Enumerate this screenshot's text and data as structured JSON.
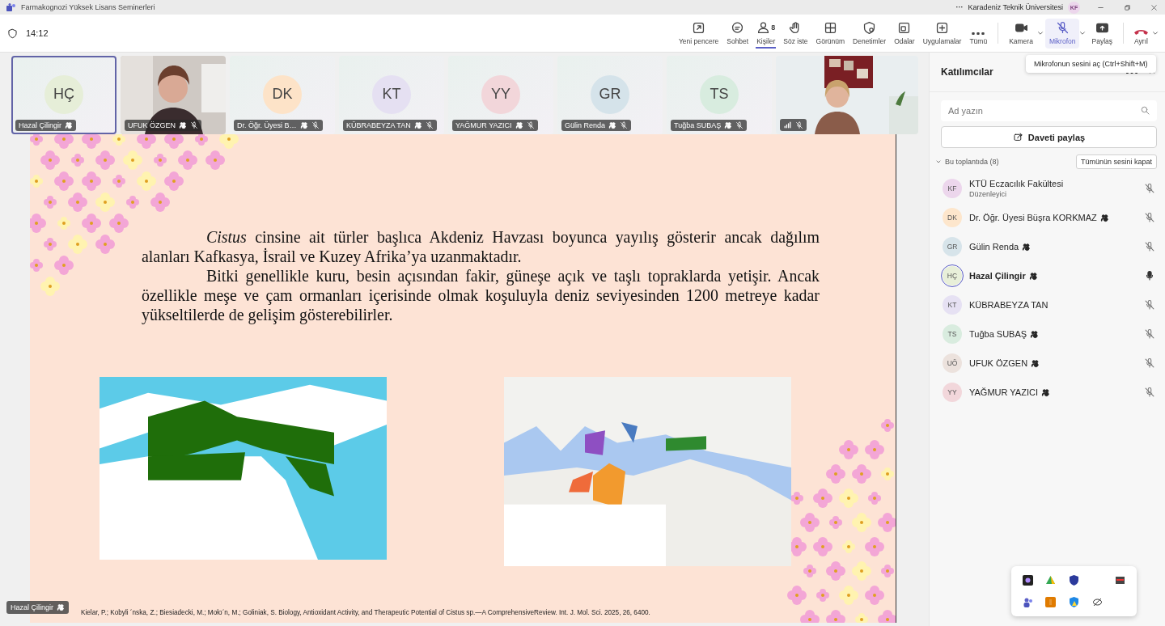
{
  "window": {
    "title": "Farmakognozi Yüksek Lisans Seminerleri",
    "more": "···",
    "organization": "Karadeniz Teknik Üniversitesi",
    "account_initials": "KF"
  },
  "meeting": {
    "duration": "14:12"
  },
  "toolbar": [
    {
      "label": "Yeni pencere",
      "kind": "popout",
      "selected": false,
      "hovered": false,
      "has_menu": false
    },
    {
      "label": "Sohbet",
      "kind": "chat",
      "selected": false,
      "hovered": false,
      "has_menu": false
    },
    {
      "label": "Kişiler",
      "kind": "people",
      "count": "8",
      "selected": true,
      "hovered": false,
      "has_menu": false
    },
    {
      "label": "Söz iste",
      "kind": "hand",
      "selected": false,
      "hovered": false,
      "has_menu": false
    },
    {
      "label": "Görünüm",
      "kind": "grid",
      "selected": false,
      "hovered": false,
      "has_menu": false
    },
    {
      "label": "Denetimler",
      "kind": "shield",
      "selected": false,
      "hovered": false,
      "has_menu": false
    },
    {
      "label": "Odalar",
      "kind": "rooms",
      "selected": false,
      "hovered": false,
      "has_menu": false
    },
    {
      "label": "Uygulamalar",
      "kind": "add",
      "selected": false,
      "hovered": false,
      "has_menu": false
    },
    {
      "label": "Tümü",
      "kind": "more",
      "selected": false,
      "hovered": false,
      "has_menu": false,
      "divider_after": true
    },
    {
      "label": "Kamera",
      "kind": "camera",
      "selected": false,
      "hovered": false,
      "has_menu": true
    },
    {
      "label": "Mikrofon",
      "kind": "micoff",
      "selected": false,
      "hovered": true,
      "has_menu": true
    },
    {
      "label": "Paylaş",
      "kind": "share",
      "selected": false,
      "hovered": false,
      "has_menu": false,
      "divider_after": true
    },
    {
      "label": "Ayrıl",
      "kind": "leave",
      "selected": false,
      "hovered": false,
      "has_menu": true
    }
  ],
  "tiles": [
    {
      "kind": "avatar",
      "initials": "HÇ",
      "name": "Hazal Çilingir",
      "color": "#e6eed8",
      "selected": true,
      "muted": false
    },
    {
      "kind": "video",
      "name": "UFUK ÖZGEN",
      "selected": false,
      "muted": true
    },
    {
      "kind": "avatar",
      "initials": "DK",
      "name": "Dr. Öğr. Üyesi B…",
      "color": "#fde3c8",
      "selected": false,
      "muted": true
    },
    {
      "kind": "avatar",
      "initials": "KT",
      "name": "KÜBRABEYZA TAN",
      "color": "#e5e0f2",
      "selected": false,
      "muted": true
    },
    {
      "kind": "avatar",
      "initials": "YY",
      "name": "YAĞMUR YAZICI",
      "color": "#f2d6da",
      "selected": false,
      "muted": true
    },
    {
      "kind": "avatar",
      "initials": "GR",
      "name": "Gülin Renda",
      "color": "#d5e3ea",
      "selected": false,
      "muted": true
    },
    {
      "kind": "avatar",
      "initials": "TS",
      "name": "Tuğba SUBAŞ",
      "color": "#d8ecdf",
      "selected": false,
      "muted": true
    },
    {
      "kind": "video",
      "selected": false,
      "muted": true
    }
  ],
  "slide": {
    "paragraphs": [
      "*Cistus* cinsine ait türler başlıca Akdeniz Havzası boyunca yayılış gösterir ancak dağılım alanları Kafkasya, İsrail ve Kuzey Afrika’ya uzanmaktadır.",
      "Bitki genellikle kuru, besin açısından fakir, güneşe açık ve taşlı topraklarda yetişir. Ancak özellikle meşe ve çam ormanları içerisinde olmak koşuluyla deniz seviyesinden 1200 metreye kadar yükseltilerde de gelişim gösterebilirler."
    ],
    "citation": "Kielar, P.; Kobyli ´nska, Z.; Biesiadecki, M.; Mołoˊn, M.; Goliniak, S. Biology, Antioxidant Activity, and Therapeutic Potential of Cistus sp.—A ComprehensiveReview. Int. J. Mol. Sci. 2025, 26, 6400."
  },
  "presenter_tag": {
    "name": "Hazal Çilingir"
  },
  "panel": {
    "title": "Katılımcılar",
    "search": {
      "placeholder": "Ad yazın"
    },
    "share_button": "Daveti paylaş",
    "section": {
      "label": "Bu toplantıda (8)",
      "expanded": true,
      "mute_all": "Tümünün sesini kapat"
    },
    "participants": [
      {
        "initials": "KF",
        "name": "KTÜ Eczacılık Fakültesi",
        "role": "Düzenleyici",
        "color": "#ecd6ec",
        "badge": false,
        "speaking": false,
        "muted": true
      },
      {
        "initials": "DK",
        "name": "Dr. Öğr. Üyesi Büşra KORKMAZ",
        "color": "#fde6cc",
        "badge": true,
        "speaking": false,
        "muted": true
      },
      {
        "initials": "GR",
        "name": "Gülin Renda",
        "color": "#d7e4ea",
        "badge": true,
        "speaking": false,
        "muted": true
      },
      {
        "initials": "HÇ",
        "name": "Hazal Çilingir",
        "color": "#e8efd9",
        "badge": true,
        "speaking": true,
        "muted": false
      },
      {
        "initials": "KT",
        "name": "KÜBRABEYZA TAN",
        "color": "#e6e1f3",
        "badge": false,
        "speaking": false,
        "muted": true
      },
      {
        "initials": "TS",
        "name": "Tuğba SUBAŞ",
        "color": "#d9ecdf",
        "badge": true,
        "speaking": false,
        "muted": true
      },
      {
        "initials": "UÖ",
        "name": "UFUK ÖZGEN",
        "color": "#ece2dd",
        "badge": true,
        "speaking": false,
        "muted": true
      },
      {
        "initials": "YY",
        "name": "YAĞMUR YAZICI",
        "color": "#f2d7db",
        "badge": true,
        "speaking": false,
        "muted": true
      }
    ]
  },
  "tooltip": {
    "text": "Mikrofonun sesini aç (Ctrl+Shift+M)"
  }
}
